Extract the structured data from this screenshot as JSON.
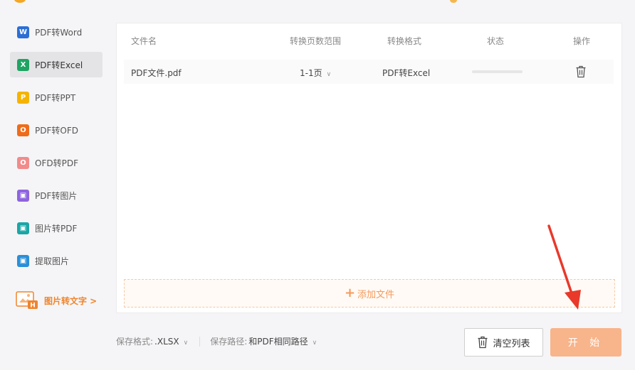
{
  "sidebar": {
    "items": [
      {
        "label": "PDF转Word",
        "icon": "word-icon",
        "glyph": "W",
        "color": "#2b6fd6",
        "active": false
      },
      {
        "label": "PDF转Excel",
        "icon": "excel-icon",
        "glyph": "X",
        "color": "#1fa463",
        "active": true
      },
      {
        "label": "PDF转PPT",
        "icon": "ppt-icon",
        "glyph": "P",
        "color": "#f5b400",
        "active": false
      },
      {
        "label": "PDF转OFD",
        "icon": "ofd-icon",
        "glyph": "O",
        "color": "#ef6c1a",
        "active": false
      },
      {
        "label": "OFD转PDF",
        "icon": "pdf-icon",
        "glyph": "O",
        "color": "#f28b8b",
        "active": false
      },
      {
        "label": "PDF转图片",
        "icon": "image-icon",
        "glyph": "▣",
        "color": "#8e63e0",
        "active": false
      },
      {
        "label": "图片转PDF",
        "icon": "image-pdf-icon",
        "glyph": "▣",
        "color": "#1aa6a6",
        "active": false
      },
      {
        "label": "提取图片",
        "icon": "extract-image-icon",
        "glyph": "▣",
        "color": "#2a8fd8",
        "active": false
      }
    ],
    "promo_label": "图片转文字 >"
  },
  "table": {
    "headers": [
      "文件名",
      "转换页数范围",
      "转换格式",
      "状态",
      "操作"
    ],
    "rows": [
      {
        "filename": "PDF文件.pdf",
        "range": "1-1页",
        "format": "PDF转Excel",
        "progress": 0
      }
    ]
  },
  "add_file_label": "添加文件",
  "footer": {
    "format_label": "保存格式:",
    "format_value": ".XLSX",
    "path_label": "保存路径:",
    "path_value": "和PDF相同路径"
  },
  "buttons": {
    "clear": "清空列表",
    "start": "开 始"
  },
  "colors": {
    "accent": "#f39a5c",
    "start_button": "#f8b48a",
    "arrow": "#e8392b"
  }
}
